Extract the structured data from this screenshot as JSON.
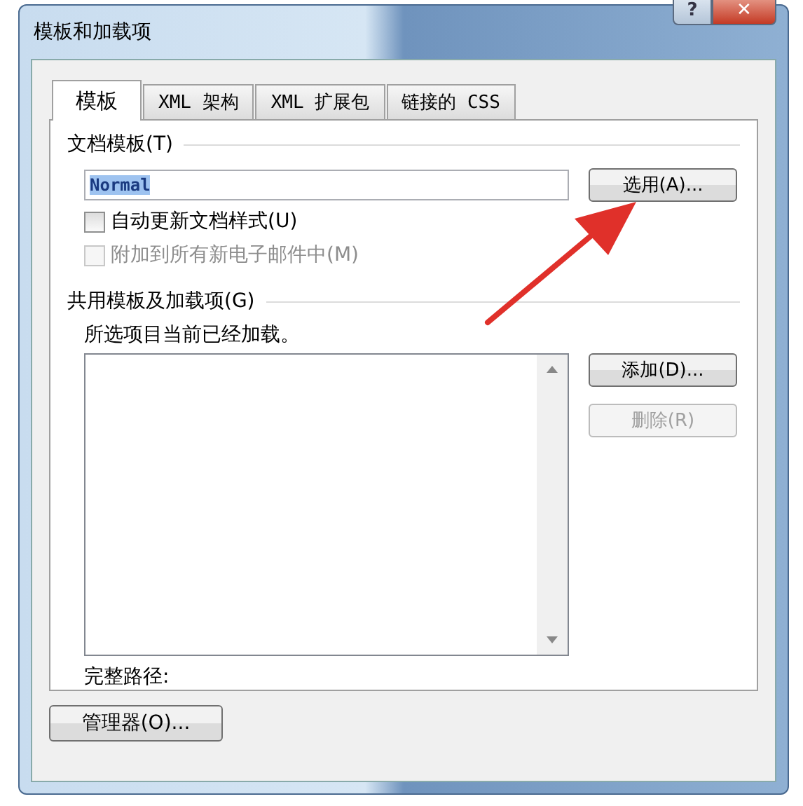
{
  "window": {
    "title": "模板和加载项",
    "buttons": [
      {
        "kind": "help",
        "label": "?"
      },
      {
        "kind": "close",
        "label": "✕"
      }
    ]
  },
  "tabs": [
    {
      "label": "模板",
      "selected": true
    },
    {
      "label": "XML 架构",
      "selected": false
    },
    {
      "label": "XML 扩展包",
      "selected": false
    },
    {
      "label": "链接的 CSS",
      "selected": false
    }
  ],
  "document_template": {
    "heading": "文档模板(T)",
    "field": {
      "value": "Normal",
      "highlighted": true
    },
    "button": {
      "label": "选用(A)...",
      "disabled": false
    },
    "checkboxes": [
      {
        "label": "自动更新文档样式(U)",
        "checked": false,
        "disabled": false
      },
      {
        "label": "附加到所有新电子邮件中(M)",
        "checked": false,
        "disabled": true
      }
    ]
  },
  "global_templates": {
    "heading": "共用模板及加载项(G)",
    "note": "所选项目当前已经加载。",
    "buttons": [
      {
        "label": "添加(D)...",
        "disabled": false
      },
      {
        "label": "删除(R)",
        "disabled": true
      }
    ],
    "full_path_label": "完整路径:"
  },
  "footer_button": {
    "label": "管理器(O)...",
    "disabled": false
  }
}
